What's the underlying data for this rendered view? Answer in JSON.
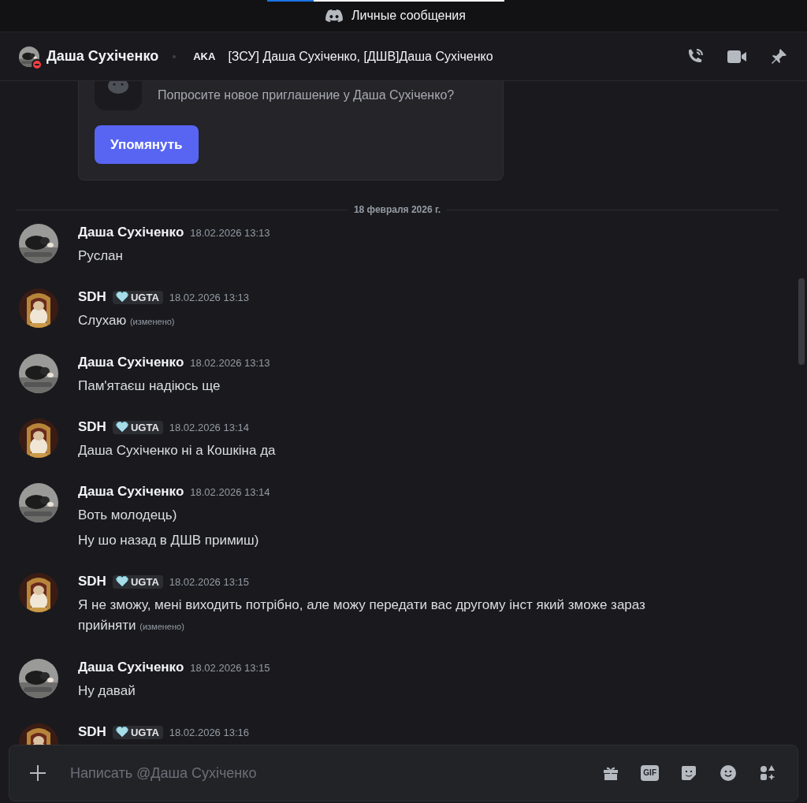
{
  "app_bar": {
    "title": "Личные сообщения"
  },
  "header": {
    "name": "Даша Сухіченко",
    "do_not_disturb": true,
    "aka_label": "AKA",
    "aka_names": "[ЗСУ] Даша Сухіченко, [ДШВ]Даша Сухіченко"
  },
  "invite": {
    "text": "Попросите новое приглашение у Даша Сухіченко?",
    "button": "Упомянуть"
  },
  "date_divider": "18 февраля 2026 г.",
  "messages": [
    {
      "author": "Даша Сухіченко",
      "kind": "gray",
      "time": "18.02.2026 13:13",
      "lines": [
        {
          "text": "Руслан"
        }
      ]
    },
    {
      "author": "SDH",
      "kind": "gold",
      "tag": "UGTA",
      "time": "18.02.2026 13:13",
      "lines": [
        {
          "text": "Слухаю",
          "edited_note": "(изменено)"
        }
      ]
    },
    {
      "author": "Даша Сухіченко",
      "kind": "gray",
      "time": "18.02.2026 13:13",
      "lines": [
        {
          "text": "Пам'ятаєш надіюсь ще"
        }
      ]
    },
    {
      "author": "SDH",
      "kind": "gold",
      "tag": "UGTA",
      "time": "18.02.2026 13:14",
      "lines": [
        {
          "text": "Даша Сухіченко ні а Кошкіна да"
        }
      ]
    },
    {
      "author": "Даша Сухіченко",
      "kind": "gray",
      "time": "18.02.2026 13:14",
      "lines": [
        {
          "text": "Воть молодець)"
        },
        {
          "text": "Ну шо назад в ДШВ примиш)"
        }
      ]
    },
    {
      "author": "SDH",
      "kind": "gold",
      "tag": "UGTA",
      "time": "18.02.2026 13:15",
      "lines": [
        {
          "text": "Я не зможу, мені виходить потрібно, але можу передати вас другому інст який зможе зараз прийняти",
          "edited_note": "(изменено)"
        }
      ]
    },
    {
      "author": "Даша Сухіченко",
      "kind": "gray",
      "time": "18.02.2026 13:15",
      "lines": [
        {
          "text": "Ну давай"
        }
      ]
    },
    {
      "author": "SDH",
      "kind": "gold",
      "tag": "UGTA",
      "time": "18.02.2026 13:16"
    }
  ],
  "composer": {
    "placeholder": "Написать @Даша Сухіченко",
    "tools": [
      {
        "kind": "gift"
      },
      {
        "kind": "gif",
        "label": "GIF"
      },
      {
        "kind": "sticker"
      },
      {
        "kind": "emoji"
      },
      {
        "kind": "apps"
      }
    ]
  }
}
